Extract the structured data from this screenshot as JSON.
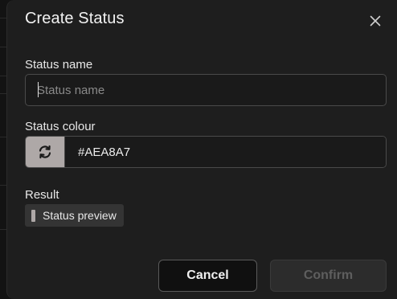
{
  "dialog": {
    "title": "Create Status"
  },
  "name_field": {
    "label": "Status name",
    "placeholder": "Status name",
    "value": ""
  },
  "colour_field": {
    "label": "Status colour",
    "value": "#AEA8A7",
    "swatch_icon": "refresh-icon"
  },
  "result": {
    "label": "Result",
    "preview_text": "Status preview"
  },
  "footer": {
    "cancel_label": "Cancel",
    "confirm_label": "Confirm"
  },
  "colors": {
    "status": "#AEA8A7"
  }
}
